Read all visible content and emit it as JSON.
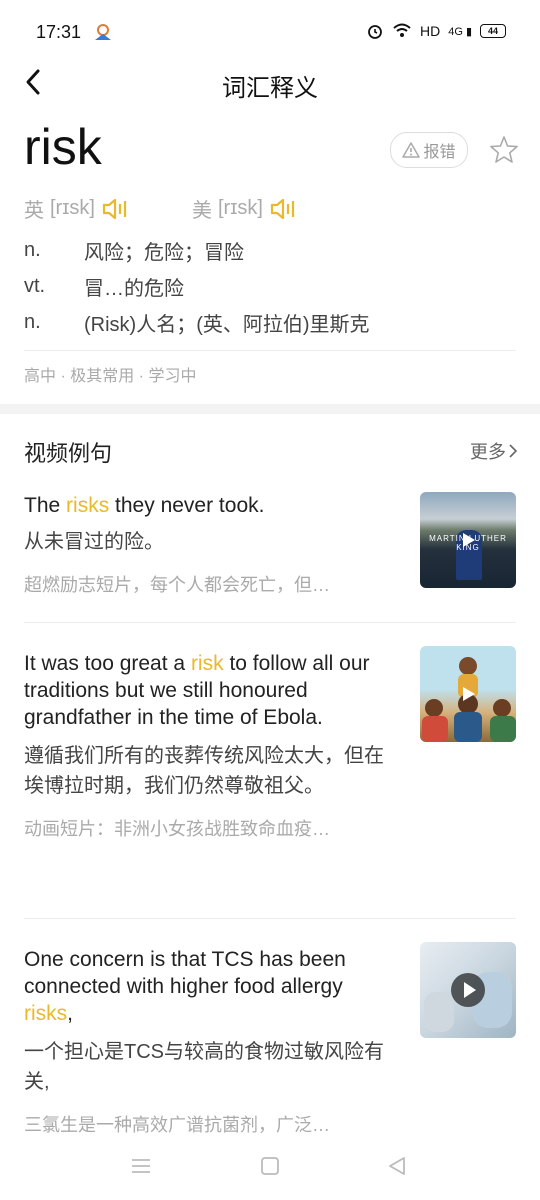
{
  "status": {
    "time": "17:31",
    "network": "HD",
    "signal": "4G",
    "battery": "44"
  },
  "nav": {
    "title": "词汇释义"
  },
  "entry": {
    "word": "risk",
    "report_label": "报错",
    "uk": {
      "label": "英",
      "ipa": "[rɪsk]"
    },
    "us": {
      "label": "美",
      "ipa": "[rɪsk]"
    },
    "definitions": [
      {
        "pos": "n.",
        "text": "风险；危险；冒险"
      },
      {
        "pos": "vt.",
        "text": "冒…的危险"
      },
      {
        "pos": "n.",
        "text": "(Risk)人名；(英、阿拉伯)里斯克"
      }
    ],
    "levels": "高中 · 极其常用 · 学习中"
  },
  "video_section": {
    "title": "视频例句",
    "more": "更多"
  },
  "examples": [
    {
      "en_before": "The ",
      "en_hl": "risks",
      "en_after": " they never took.",
      "zh": "从未冒过的险。",
      "src": "超燃励志短片，每个人都会死亡，但…",
      "thumb_caption": "MARTIN LUTHER KING"
    },
    {
      "en_before": "It was too great a ",
      "en_hl": "risk",
      "en_after": " to follow all our traditions but we still honoured grandfather in the time of Ebola.",
      "zh": "遵循我们所有的丧葬传统风险太大，但在埃博拉时期，我们仍然尊敬祖父。",
      "src": "动画短片：非洲小女孩战胜致命血疫…"
    },
    {
      "en_before": "One concern is that TCS has been connected with higher food allergy ",
      "en_hl": "risks",
      "en_after": ",",
      "zh": "一个担心是TCS与较高的食物过敏风险有关,",
      "src": "三氯生是一种高效广谱抗菌剂，广泛…"
    }
  ],
  "icons": {
    "back": "chevron-left-icon",
    "star": "star-icon",
    "speaker": "speaker-icon",
    "play": "play-icon",
    "warning": "warning-icon"
  },
  "colors": {
    "accent": "#e9b92a"
  }
}
